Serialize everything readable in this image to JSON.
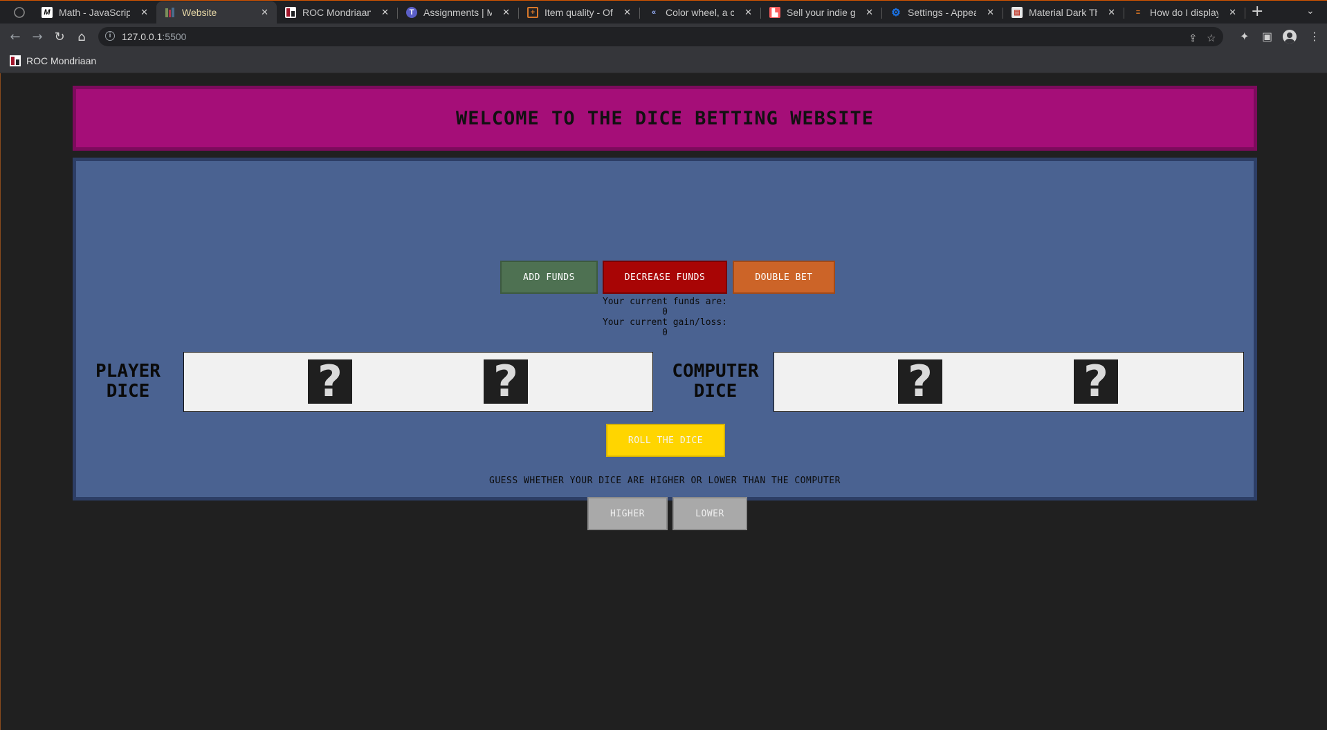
{
  "browser": {
    "tabs": [
      {
        "title": "Math - JavaScript",
        "favicon": "mdn-icon"
      },
      {
        "title": "Website",
        "favicon": "bars-icon",
        "active": true
      },
      {
        "title": "ROC Mondriaan",
        "favicon": "roc-icon"
      },
      {
        "title": "Assignments | M",
        "favicon": "teams-icon"
      },
      {
        "title": "Item quality - Of",
        "favicon": "wiki-icon"
      },
      {
        "title": "Color wheel, a co",
        "favicon": "color-wheel-icon"
      },
      {
        "title": "Sell your indie ga",
        "favicon": "itch-icon"
      },
      {
        "title": "Settings - Appea",
        "favicon": "gear-icon"
      },
      {
        "title": "Material Dark Th",
        "favicon": "store-icon"
      },
      {
        "title": "How do I display",
        "favicon": "stackoverflow-icon"
      }
    ],
    "url_host": "127.0.0.1",
    "url_port": ":5500",
    "bookmarks": [
      {
        "label": "ROC Mondriaan",
        "favicon": "roc-icon"
      }
    ]
  },
  "page": {
    "title": "WELCOME TO THE DICE BETTING WEBSITE",
    "buttons": {
      "add_funds": "ADD FUNDS",
      "decrease_funds": "DECREASE FUNDS",
      "double_bet": "DOUBLE BET",
      "roll": "ROLL THE DICE",
      "higher": "HIGHER",
      "lower": "LOWER"
    },
    "funds_label": "Your current funds are:",
    "funds_value": "0",
    "gain_label": "Your current gain/loss:",
    "gain_value": "0",
    "player_label_line1": "PLAYER",
    "player_label_line2": "DICE",
    "computer_label_line1": "COMPUTER",
    "computer_label_line2": "DICE",
    "die_placeholder": "?",
    "guess_prompt": "GUESS WHETHER YOUR DICE ARE HIGHER OR LOWER THAN THE COMPUTER",
    "colors": {
      "banner": "#a50e78",
      "panel": "#4a6291",
      "add_funds": "#4e7152",
      "decrease_funds": "#a80505",
      "double_bet": "#cc6428",
      "roll": "#ffd500",
      "guess_buttons": "#a9a9a9"
    }
  }
}
